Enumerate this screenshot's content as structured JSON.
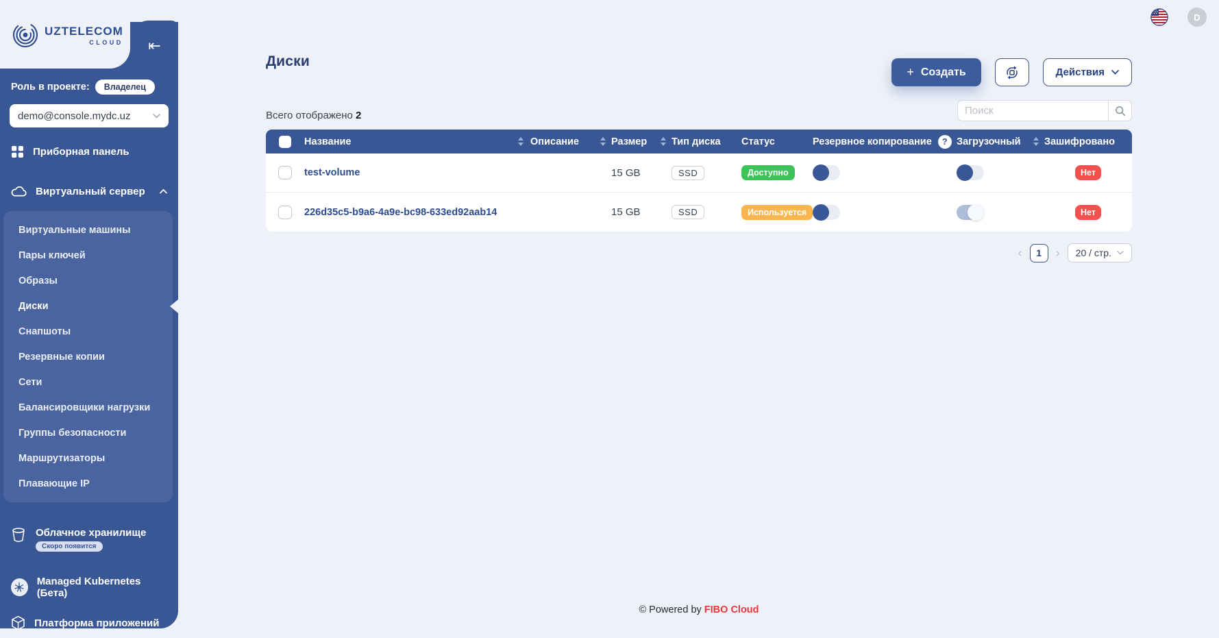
{
  "colors": {
    "sidebar_blue": "#3A5795",
    "submenu_blue": "#4A64A0",
    "table_header_blue": "#3A5795",
    "create_button_blue": "#3C5C9E",
    "page_background": "#EEF2F8",
    "link_blue": "#2D4B8F",
    "status_available_green": "#3EC35A",
    "status_in_use_orange": "#F9B64E",
    "status_no_red": "#F4514E",
    "footer_brand_red": "#E8363D"
  },
  "topbar": {
    "avatar_initial": "D"
  },
  "sidebar": {
    "logo_brand": "UZTELECOM",
    "logo_sub": "CLOUD",
    "collapse_glyph": "⇤",
    "role_label": "Роль в проекте:",
    "role_value": "Владелец",
    "project_select_value": "demo@console.mydc.uz",
    "dashboard_label": "Приборная панель",
    "server_group_label": "Виртуальный сервер",
    "submenu": [
      "Виртуальные машины",
      "Пары ключей",
      "Образы",
      "Диски",
      "Снапшоты",
      "Резервные копии",
      "Сети",
      "Балансировщики нагрузки",
      "Группы безопасности",
      "Маршрутизаторы",
      "Плавающие IP"
    ],
    "active_submenu_item": "Диски",
    "storage_label": "Облачное хранилище",
    "storage_badge": "Скоро появится",
    "kubernetes_label": "Managed Kubernetes (Бета)",
    "apps_label": "Платформа приложений"
  },
  "main": {
    "title": "Диски",
    "create_plus": "+",
    "create_label": "Создать",
    "actions_label": "Действия",
    "total_label": "Всего отображено",
    "total_count": "2",
    "search_placeholder": "Поиск",
    "table": {
      "help_glyph": "?",
      "columns": [
        {
          "label": "Название",
          "sortable": true
        },
        {
          "label": "Описание",
          "sortable": true
        },
        {
          "label": "Размер",
          "sortable": true
        },
        {
          "label": "Тип диска",
          "sortable": false
        },
        {
          "label": "Статус",
          "sortable": false
        },
        {
          "label": "Резервное копирование",
          "help": true
        },
        {
          "label": "Загрузочный",
          "sortable": true
        },
        {
          "label": "Зашифровано",
          "sortable": false
        }
      ],
      "rows": [
        {
          "name": "test-volume",
          "description": "",
          "size": "15 GB",
          "disk_type": "SSD",
          "status": "Доступно",
          "status_color": "green",
          "backup_enabled": false,
          "bootable_enabled": false,
          "encrypted": "Нет"
        },
        {
          "name": "226d35c5-b9a6-4a9e-bc98-633ed92aab14",
          "description": "",
          "size": "15 GB",
          "disk_type": "SSD",
          "status": "Используется",
          "status_color": "orange",
          "backup_enabled": false,
          "bootable_enabled": true,
          "encrypted": "Нет"
        }
      ]
    },
    "pagination": {
      "prev": "‹",
      "page": "1",
      "next": "›",
      "page_size": "20 / стр."
    },
    "footer_prefix": "© Powered by ",
    "footer_brand": "FIBO Cloud"
  }
}
